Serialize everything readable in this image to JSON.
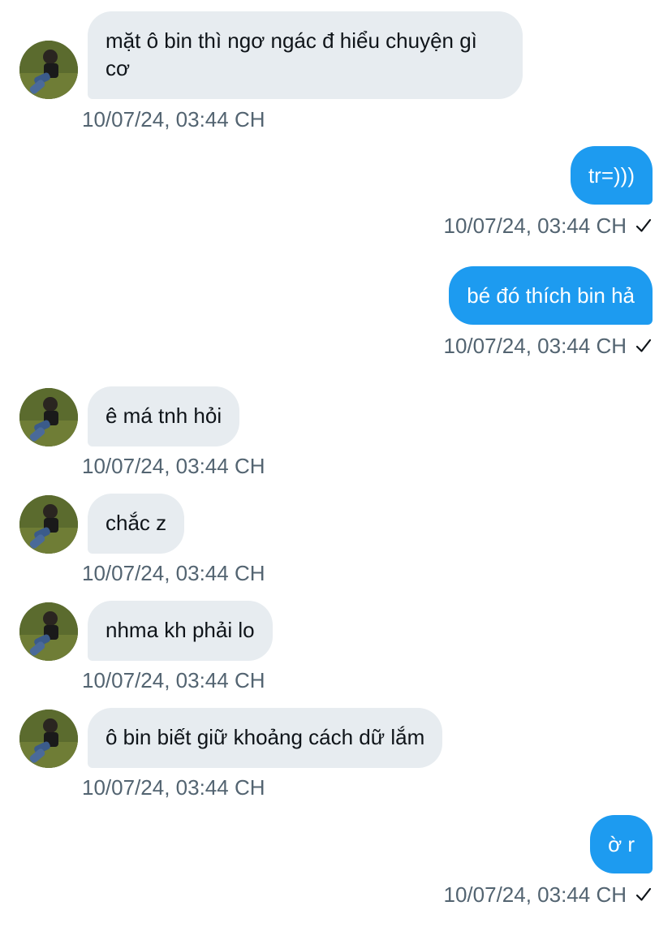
{
  "conversation": {
    "messages": [
      {
        "direction": "in",
        "text": "mặt ô bin thì ngơ ngác đ hiểu chuyện gì cơ",
        "timestamp": "10/07/24, 03:44 CH"
      },
      {
        "direction": "out",
        "text": "tr=)))",
        "timestamp": "10/07/24, 03:44 CH",
        "status": "sent"
      },
      {
        "direction": "out",
        "text": "bé đó thích bin hả",
        "timestamp": "10/07/24, 03:44 CH",
        "status": "sent"
      },
      {
        "direction": "in",
        "text": "ê má tnh hỏi",
        "timestamp": "10/07/24, 03:44 CH"
      },
      {
        "direction": "in",
        "text": "chắc z",
        "timestamp": "10/07/24, 03:44 CH"
      },
      {
        "direction": "in",
        "text": "nhma kh phải lo",
        "timestamp": "10/07/24, 03:44 CH"
      },
      {
        "direction": "in",
        "text": "ô bin biết giữ khoảng cách dữ lắm",
        "timestamp": "10/07/24, 03:44 CH"
      },
      {
        "direction": "out",
        "text": "ờ r",
        "timestamp": "10/07/24, 03:44 CH",
        "status": "sent"
      }
    ]
  },
  "icons": {
    "avatar": "user-avatar-photo",
    "check": "check-icon"
  },
  "colors": {
    "outgoing_bubble": "#1d9bf0",
    "incoming_bubble": "#e7ecf0",
    "timestamp": "#536471",
    "text": "#0f1419"
  }
}
